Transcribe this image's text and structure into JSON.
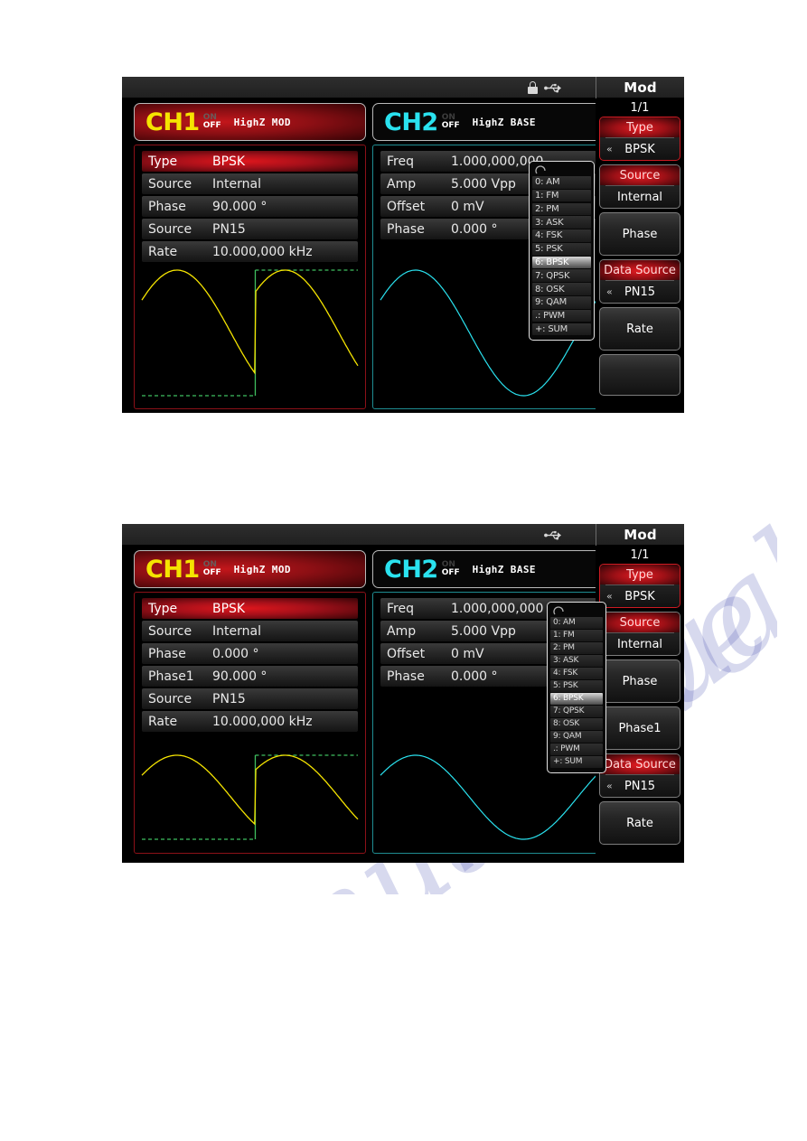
{
  "screens": [
    {
      "id": "screen-1",
      "statusbar": {
        "icons": [
          "lock-icon",
          "usb-icon"
        ],
        "title": "Mod"
      },
      "channels": [
        {
          "name": "CH1",
          "on": "ON",
          "off": "OFF",
          "meta": "HighZ MOD",
          "active": true
        },
        {
          "name": "CH2",
          "on": "ON",
          "off": "OFF",
          "meta": "HighZ BASE",
          "active": false
        }
      ],
      "panel_left": [
        {
          "label": "Type",
          "value": "BPSK",
          "highlight": true
        },
        {
          "label": "Source",
          "value": "Internal",
          "highlight": false
        },
        {
          "label": "Phase",
          "value": "90.000 °",
          "highlight": false
        },
        {
          "label": "Source",
          "value": "PN15",
          "highlight": false
        },
        {
          "label": "Rate",
          "value": "10.000,000 kHz",
          "highlight": false
        }
      ],
      "panel_right": [
        {
          "label": "Freq",
          "value": "1.000,000,000",
          "highlight": false
        },
        {
          "label": "Amp",
          "value": "5.000 Vpp",
          "highlight": false
        },
        {
          "label": "Offset",
          "value": "0 mV",
          "highlight": false
        },
        {
          "label": "Phase",
          "value": "0.000 °",
          "highlight": false
        }
      ],
      "dropdown": {
        "selected": "6: BPSK",
        "items": [
          "0: AM",
          "1: FM",
          "2: PM",
          "3: ASK",
          "4: FSK",
          "5: PSK",
          "6: BPSK",
          "7: QPSK",
          "8: OSK",
          "9: QAM",
          ".: PWM",
          "+: SUM"
        ]
      },
      "sidebar": {
        "page": "1/1",
        "keys": [
          {
            "title": "Type",
            "value": "BPSK",
            "red": true,
            "chevron": true,
            "active": true
          },
          {
            "title": "Source",
            "value": "Internal",
            "red": true,
            "chevron": false,
            "active": false
          },
          {
            "title": "Phase",
            "value": "",
            "red": false,
            "chevron": false,
            "active": false
          },
          {
            "title": "Data Source",
            "value": "PN15",
            "red": true,
            "chevron": true,
            "active": false
          },
          {
            "title": "Rate",
            "value": "",
            "red": false,
            "chevron": false,
            "active": false
          },
          {
            "title": "",
            "value": "",
            "red": false,
            "chevron": false,
            "active": false
          }
        ]
      }
    },
    {
      "id": "screen-2",
      "statusbar": {
        "icons": [
          "usb-icon"
        ],
        "title": "Mod"
      },
      "channels": [
        {
          "name": "CH1",
          "on": "ON",
          "off": "OFF",
          "meta": "HighZ MOD",
          "active": true
        },
        {
          "name": "CH2",
          "on": "ON",
          "off": "OFF",
          "meta": "HighZ BASE",
          "active": false
        }
      ],
      "panel_left": [
        {
          "label": "Type",
          "value": "BPSK",
          "highlight": true
        },
        {
          "label": "Source",
          "value": "Internal",
          "highlight": false
        },
        {
          "label": "Phase",
          "value": "0.000 °",
          "highlight": false
        },
        {
          "label": "Phase1",
          "value": "90.000 °",
          "highlight": false
        },
        {
          "label": "Source",
          "value": "PN15",
          "highlight": false
        },
        {
          "label": "Rate",
          "value": "10.000,000 kHz",
          "highlight": false
        }
      ],
      "panel_right": [
        {
          "label": "Freq",
          "value": "1.000,000,000 kHz",
          "highlight": false
        },
        {
          "label": "Amp",
          "value": "5.000 Vpp",
          "highlight": false
        },
        {
          "label": "Offset",
          "value": "0 mV",
          "highlight": false
        },
        {
          "label": "Phase",
          "value": "0.000 °",
          "highlight": false
        }
      ],
      "dropdown": {
        "selected": "6: BPSK",
        "items": [
          "0: AM",
          "1: FM",
          "2: PM",
          "3: ASK",
          "4: FSK",
          "5: PSK",
          "6: BPSK",
          "7: QPSK",
          "8: OSK",
          "9: QAM",
          ".: PWM",
          "+: SUM"
        ]
      },
      "sidebar": {
        "page": "1/1",
        "keys": [
          {
            "title": "Type",
            "value": "BPSK",
            "red": true,
            "chevron": true,
            "active": true
          },
          {
            "title": "Source",
            "value": "Internal",
            "red": true,
            "chevron": false,
            "active": false
          },
          {
            "title": "Phase",
            "value": "",
            "red": false,
            "chevron": false,
            "active": false
          },
          {
            "title": "Phase1",
            "value": "",
            "red": false,
            "chevron": false,
            "active": false
          },
          {
            "title": "Data Source",
            "value": "PN15",
            "red": true,
            "chevron": true,
            "active": false
          },
          {
            "title": "Rate",
            "value": "",
            "red": false,
            "chevron": false,
            "active": false
          }
        ]
      }
    }
  ],
  "watermark": {
    "line1": "manualslive.com",
    "line2": "manualslive.com"
  },
  "colors": {
    "ch1": "#f5e400",
    "ch2": "#2ae2ef",
    "accent_red": "#cd1a22",
    "modulation": "#3fbf5f",
    "screen_bg": "#000000"
  }
}
